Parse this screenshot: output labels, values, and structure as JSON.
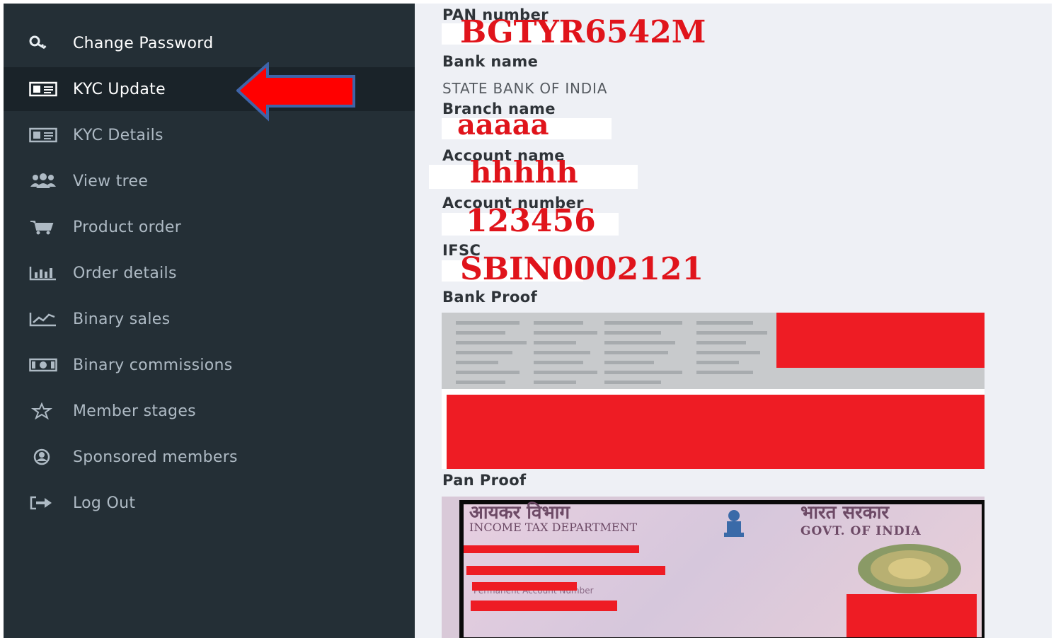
{
  "sidebar": {
    "items": [
      {
        "label": "Change Password",
        "icon": "key-icon"
      },
      {
        "label": "KYC Update",
        "icon": "id-card-icon",
        "active": true
      },
      {
        "label": "KYC Details",
        "icon": "id-card-icon"
      },
      {
        "label": "View tree",
        "icon": "users-icon"
      },
      {
        "label": "Product order",
        "icon": "cart-icon"
      },
      {
        "label": "Order details",
        "icon": "bar-chart-icon"
      },
      {
        "label": "Binary sales",
        "icon": "line-chart-icon"
      },
      {
        "label": "Binary commissions",
        "icon": "money-icon"
      },
      {
        "label": "Member stages",
        "icon": "star-icon"
      },
      {
        "label": "Sponsored members",
        "icon": "user-circle-icon"
      },
      {
        "label": "Log Out",
        "icon": "sign-out-icon"
      }
    ]
  },
  "kyc": {
    "pan_label": "PAN number",
    "pan_value": "BGTYR6542M",
    "bank_name_label": "Bank name",
    "bank_name_value": "STATE BANK OF INDIA",
    "branch_label": "Branch name",
    "branch_value": "aaaaa",
    "account_name_label": "Account name",
    "account_name_value": "hhhhh",
    "account_number_label": "Account number",
    "account_number_value": "123456",
    "ifsc_label": "IFSC",
    "ifsc_value": "SBIN0002121",
    "bank_proof_label": "Bank Proof",
    "pan_proof_label": "Pan Proof"
  },
  "pan_card": {
    "dept_hindi": "आयकर विभाग",
    "dept_english": "INCOME TAX DEPARTMENT",
    "govt_hindi": "भारत सरकार",
    "govt_english": "GOVT. OF INDIA",
    "pan_caption": "Permanent Account Number"
  },
  "colors": {
    "sidebar_bg": "#242f36",
    "sidebar_active_bg": "#1a2329",
    "sidebar_text": "#aebac4",
    "content_bg": "#eef0f5",
    "overlay_red": "#e0141b",
    "arrow_red": "#ff0000",
    "arrow_border": "#3f64a8"
  }
}
